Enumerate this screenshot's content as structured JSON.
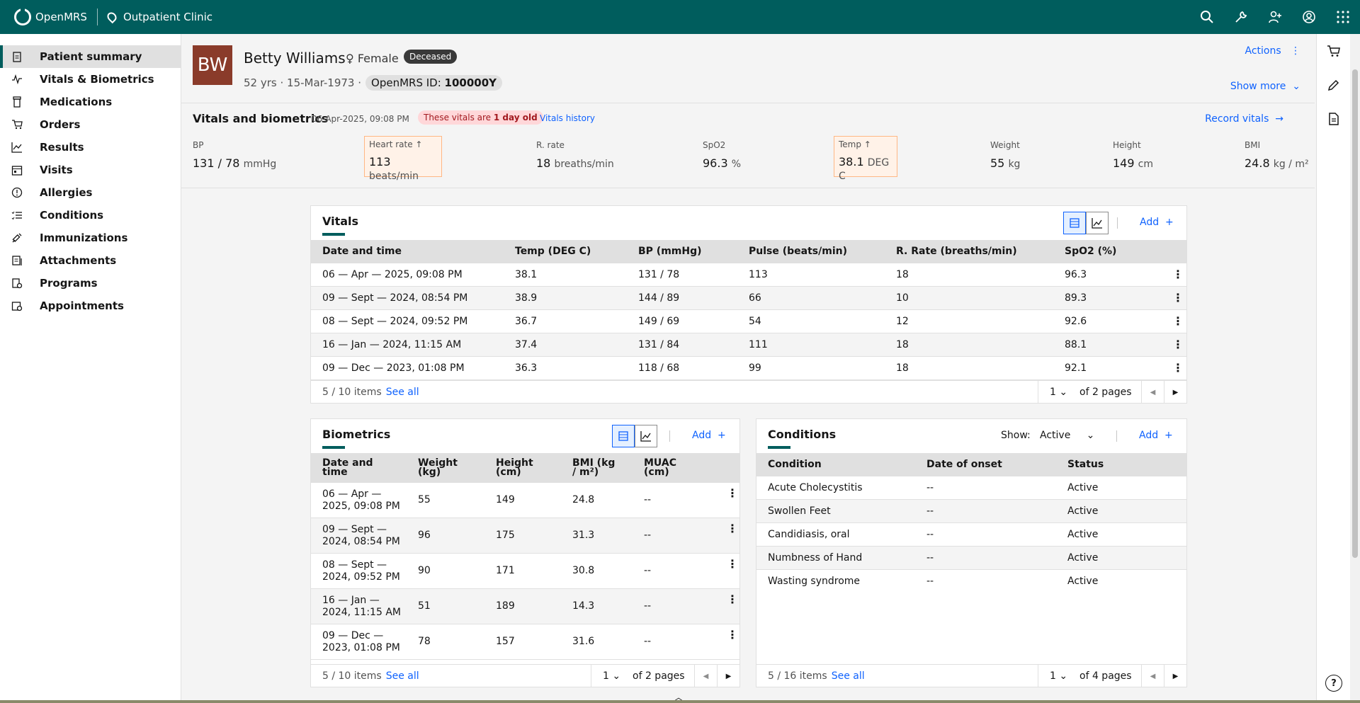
{
  "topbar": {
    "brand": "OpenMRS",
    "location": "Outpatient Clinic",
    "icons": [
      "search-icon",
      "tools-icon",
      "add-user-icon",
      "user-avatar-icon",
      "app-switcher-icon"
    ]
  },
  "sidebar": {
    "items": [
      {
        "label": "Patient summary",
        "icon": "clipboard-icon"
      },
      {
        "label": "Vitals & Biometrics",
        "icon": "activity-icon"
      },
      {
        "label": "Medications",
        "icon": "medication-icon"
      },
      {
        "label": "Orders",
        "icon": "cart-icon"
      },
      {
        "label": "Results",
        "icon": "chart-icon"
      },
      {
        "label": "Visits",
        "icon": "calendar-icon"
      },
      {
        "label": "Allergies",
        "icon": "warning-icon"
      },
      {
        "label": "Conditions",
        "icon": "list-icon"
      },
      {
        "label": "Immunizations",
        "icon": "syringe-icon"
      },
      {
        "label": "Attachments",
        "icon": "document-icon"
      },
      {
        "label": "Programs",
        "icon": "program-icon"
      },
      {
        "label": "Appointments",
        "icon": "appointment-icon"
      }
    ]
  },
  "patient": {
    "initials": "BW",
    "name": "Betty Williams",
    "gender": "Female",
    "status": "Deceased",
    "age": "52 yrs",
    "dob": "15-Mar-1973",
    "id_label": "OpenMRS ID:",
    "id_value": "100000Y",
    "actions": "Actions",
    "show_more": "Show more"
  },
  "vitals_header": {
    "title": "Vitals and biometrics",
    "date": "06-Apr-2025, 09:08 PM",
    "age_prefix": "These vitals are ",
    "age_bold": "1 day old",
    "history": "Vitals history",
    "record": "Record vitals",
    "cells": [
      {
        "label": "BP",
        "value": "131 / 78",
        "unit": "mmHg"
      },
      {
        "label": "Heart rate ↑",
        "value": "113",
        "unit": "beats/min"
      },
      {
        "label": "R. rate",
        "value": "18",
        "unit": "breaths/min"
      },
      {
        "label": "SpO2",
        "value": "96.3",
        "unit": "%"
      },
      {
        "label": "Temp ↑",
        "value": "38.1",
        "unit": "DEG C"
      },
      {
        "label": "Weight",
        "value": "55",
        "unit": "kg"
      },
      {
        "label": "Height",
        "value": "149",
        "unit": "cm"
      },
      {
        "label": "BMI",
        "value": "24.8",
        "unit": "kg / m²"
      }
    ]
  },
  "vitals_card": {
    "title": "Vitals",
    "add": "Add",
    "columns": [
      "Date and time",
      "Temp (DEG C)",
      "BP (mmHg)",
      "Pulse (beats/min)",
      "R. Rate (breaths/min)",
      "SpO2 (%)"
    ],
    "rows": [
      [
        "06 — Apr — 2025, 09:08 PM",
        "38.1",
        "131 / 78",
        "113",
        "18",
        "96.3"
      ],
      [
        "09 — Sept — 2024, 08:54 PM",
        "38.9",
        "144 / 89",
        "66",
        "10",
        "89.3"
      ],
      [
        "08 — Sept — 2024, 09:52 PM",
        "36.7",
        "149 / 69",
        "54",
        "12",
        "92.6"
      ],
      [
        "16 — Jan — 2024, 11:15 AM",
        "37.4",
        "131 / 84",
        "111",
        "18",
        "88.1"
      ],
      [
        "09 — Dec — 2023, 01:08 PM",
        "36.3",
        "118 / 68",
        "99",
        "18",
        "92.1"
      ]
    ],
    "items": "5 / 10 items",
    "see_all": "See all",
    "page": "1",
    "of_pages": "of 2 pages"
  },
  "biometrics_card": {
    "title": "Biometrics",
    "add": "Add",
    "columns": [
      [
        "Date and",
        "time"
      ],
      [
        "Weight",
        "(kg)"
      ],
      [
        "Height",
        "(cm)"
      ],
      [
        "BMI (kg",
        "/ m²)"
      ],
      [
        "MUAC",
        "(cm)"
      ]
    ],
    "rows": [
      [
        [
          "06 — Apr —",
          "2025, 09:08 PM"
        ],
        "55",
        "149",
        "24.8",
        "--"
      ],
      [
        [
          "09 — Sept —",
          "2024, 08:54 PM"
        ],
        "96",
        "175",
        "31.3",
        "--"
      ],
      [
        [
          "08 — Sept —",
          "2024, 09:52 PM"
        ],
        "90",
        "171",
        "30.8",
        "--"
      ],
      [
        [
          "16 — Jan —",
          "2024, 11:15 AM"
        ],
        "51",
        "189",
        "14.3",
        "--"
      ],
      [
        [
          "09 — Dec —",
          "2023, 01:08 PM"
        ],
        "78",
        "157",
        "31.6",
        "--"
      ]
    ],
    "items": "5 / 10 items",
    "see_all": "See all",
    "page": "1",
    "of_pages": "of 2 pages"
  },
  "conditions_card": {
    "title": "Conditions",
    "show_label": "Show:",
    "show_value": "Active",
    "add": "Add",
    "columns": [
      "Condition",
      "Date of onset",
      "Status"
    ],
    "rows": [
      [
        "Acute Cholecystitis",
        "--",
        "Active"
      ],
      [
        "Swollen Feet",
        "--",
        "Active"
      ],
      [
        "Candidiasis, oral",
        "--",
        "Active"
      ],
      [
        "Numbness of Hand",
        "--",
        "Active"
      ],
      [
        "Wasting syndrome",
        "--",
        "Active"
      ]
    ],
    "items": "5 / 16 items",
    "see_all": "See all",
    "page": "1",
    "of_pages": "of 4 pages"
  },
  "colors": {
    "brand": "#005d5d",
    "link": "#0f62fe",
    "warning_bg": "#ffd7d9"
  }
}
